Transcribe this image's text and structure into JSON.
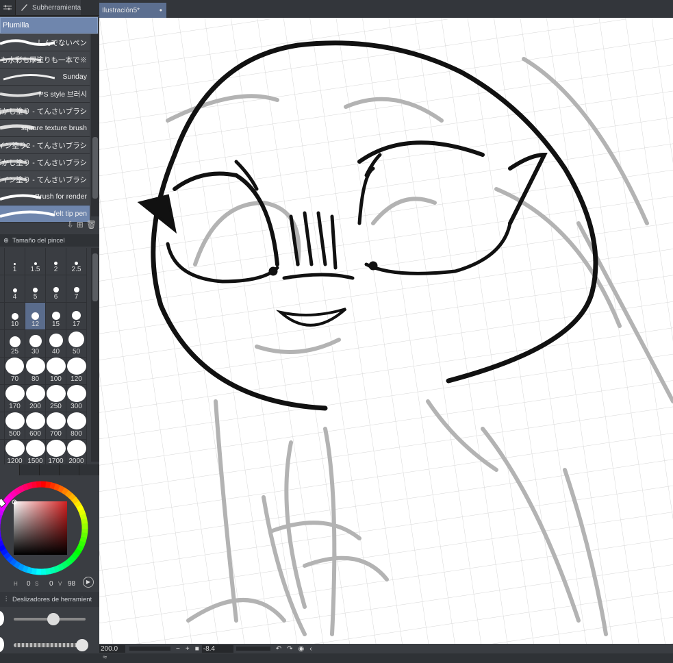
{
  "subtool": {
    "tab_label": "Subherramienta",
    "group": "Plumilla",
    "brushes": [
      {
        "label": "しんでないペン",
        "selected": false
      },
      {
        "label": "も水彩も厚塗りも一本で※",
        "selected": false
      },
      {
        "label": "Sunday",
        "selected": false
      },
      {
        "label": "PS style 브러시",
        "selected": false
      },
      {
        "label": "溶かし塗り - てんさいブラシ",
        "selected": false
      },
      {
        "label": "square texture brush",
        "selected": false
      },
      {
        "label": "メイン塗り2 - てんさいブラシ",
        "selected": false
      },
      {
        "label": "ぼかし塗り - てんさいブラシ",
        "selected": false
      },
      {
        "label": "ロメイン塗り - てんさいブラシ",
        "selected": false
      },
      {
        "label": "Brush for render",
        "selected": false
      },
      {
        "label": "felt tip pen",
        "selected": true
      }
    ]
  },
  "brush_size": {
    "title": "Tamaño del pincel",
    "sizes": [
      "1",
      "1.5",
      "2",
      "2.5",
      "4",
      "5",
      "6",
      "7",
      "10",
      "12",
      "15",
      "17",
      "25",
      "30",
      "40",
      "50",
      "70",
      "80",
      "100",
      "120",
      "170",
      "200",
      "250",
      "300",
      "500",
      "600",
      "700",
      "800",
      "1200",
      "1500",
      "1700",
      "2000"
    ],
    "selected": "12"
  },
  "color": {
    "values": {
      "h": "0",
      "s": "0",
      "v": "98"
    },
    "labels": {
      "h": "H",
      "s": "S",
      "v": "V"
    },
    "current": "#ffffff",
    "square_hue": "#d42020"
  },
  "tool_sliders": {
    "title": "Deslizadores de herramient",
    "size_level": 0.55,
    "opacity_level": 0.95
  },
  "document": {
    "tab_title": "Ilustración5*"
  },
  "status": {
    "zoom": "200.0",
    "rotation": "-8.4"
  },
  "colors": {
    "panel_bg": "#3a3d42",
    "selection": "#6f86ad",
    "canvas": "#ffffff",
    "lineart": "#111111",
    "sketch": "#b3b3b3"
  }
}
